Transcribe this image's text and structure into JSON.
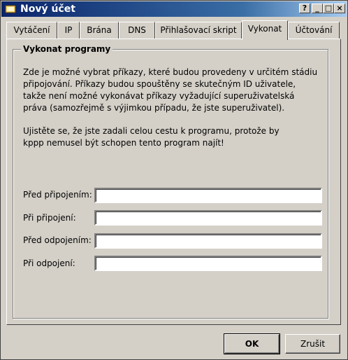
{
  "window": {
    "title": "Nový účet",
    "buttons": {
      "help": "?",
      "minimize": "_",
      "maximize": "□",
      "close": "×"
    }
  },
  "tabs": [
    {
      "label": "Vytáčení",
      "active": false
    },
    {
      "label": "IP",
      "active": false
    },
    {
      "label": "Brána",
      "active": false
    },
    {
      "label": "DNS",
      "active": false
    },
    {
      "label": "Přihlašovací skript",
      "active": false
    },
    {
      "label": "Vykonat",
      "active": true
    },
    {
      "label": "Účtování",
      "active": false
    }
  ],
  "group": {
    "title": "Vykonat programy",
    "paragraph1": "Zde je možné vybrat příkazy, které budou provedeny v určitém stádiu\npřipojování. Příkazy budou spouštěny se skutečným ID uživatele,\ntakže není možné vykonávat příkazy vyžadující superuživatelská\npráva (samozřejmě s výjimkou případu, že jste superuživatel).",
    "paragraph2": "Ujistěte se, že jste zadali celou cestu k programu, protože by\nkppp nemusel být schopen tento program najít!"
  },
  "fields": [
    {
      "label": "Před připojením:",
      "value": ""
    },
    {
      "label": "Při připojení:",
      "value": ""
    },
    {
      "label": "Před odpojením:",
      "value": ""
    },
    {
      "label": "Při odpojení:",
      "value": ""
    }
  ],
  "footer": {
    "ok": "OK",
    "cancel": "Zrušit"
  },
  "colors": {
    "titlebar": "#0a246a",
    "face": "#d4d0c8"
  }
}
